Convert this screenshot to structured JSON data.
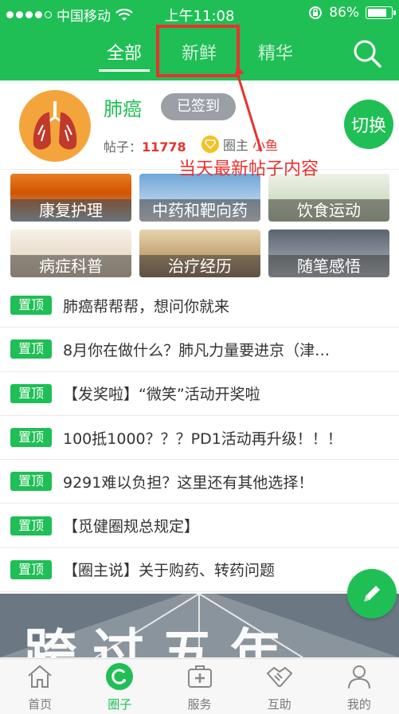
{
  "status_bar": {
    "carrier": "中国移动",
    "time": "上午11:08",
    "battery": "86%",
    "battery_level": 0.86
  },
  "tabs": [
    {
      "label": "全部",
      "active": true
    },
    {
      "label": "新鲜",
      "active": false
    },
    {
      "label": "精华",
      "active": false
    }
  ],
  "annotation": {
    "text": "当天最新帖子内容",
    "color": "#e8322e"
  },
  "circle": {
    "name": "肺癌",
    "signed_label": "已签到",
    "posts_label": "帖子：",
    "posts_count": "11778",
    "owner_label": "圈主",
    "owner_name": "小鱼",
    "switch_label": "切换"
  },
  "categories": [
    {
      "label": "康复护理",
      "icon": "umbrella-image"
    },
    {
      "label": "中药和靶向药",
      "icon": "flowers-image"
    },
    {
      "label": "饮食运动",
      "icon": "plants-image"
    },
    {
      "label": "病症科普",
      "icon": "tree-image"
    },
    {
      "label": "治疗经历",
      "icon": "landscape-image"
    },
    {
      "label": "随笔感悟",
      "icon": "room-image"
    }
  ],
  "pinned_label": "置顶",
  "pinned_posts": [
    "肺癌帮帮帮，想问你就来",
    "8月你在做什么？肺凡力量要进京（津…",
    "【发奖啦】“微笑”活动开奖啦",
    "100抵1000？？？PD1活动再升级！！！",
    "9291难以负担？这里还有其他选择！",
    "【觅健圈规总规定】",
    "【圈主说】关于购药、转药问题"
  ],
  "banner": {
    "text": "跨过五年"
  },
  "bottom_nav": [
    {
      "label": "首页",
      "icon": "home-icon",
      "active": false
    },
    {
      "label": "圈子",
      "icon": "circle-icon",
      "active": true
    },
    {
      "label": "服务",
      "icon": "medical-kit-icon",
      "active": false
    },
    {
      "label": "互助",
      "icon": "handshake-icon",
      "active": false
    },
    {
      "label": "我的",
      "icon": "user-icon",
      "active": false
    }
  ],
  "colors": {
    "brand_green": "#1fbf55",
    "accent_red": "#e8322e"
  }
}
